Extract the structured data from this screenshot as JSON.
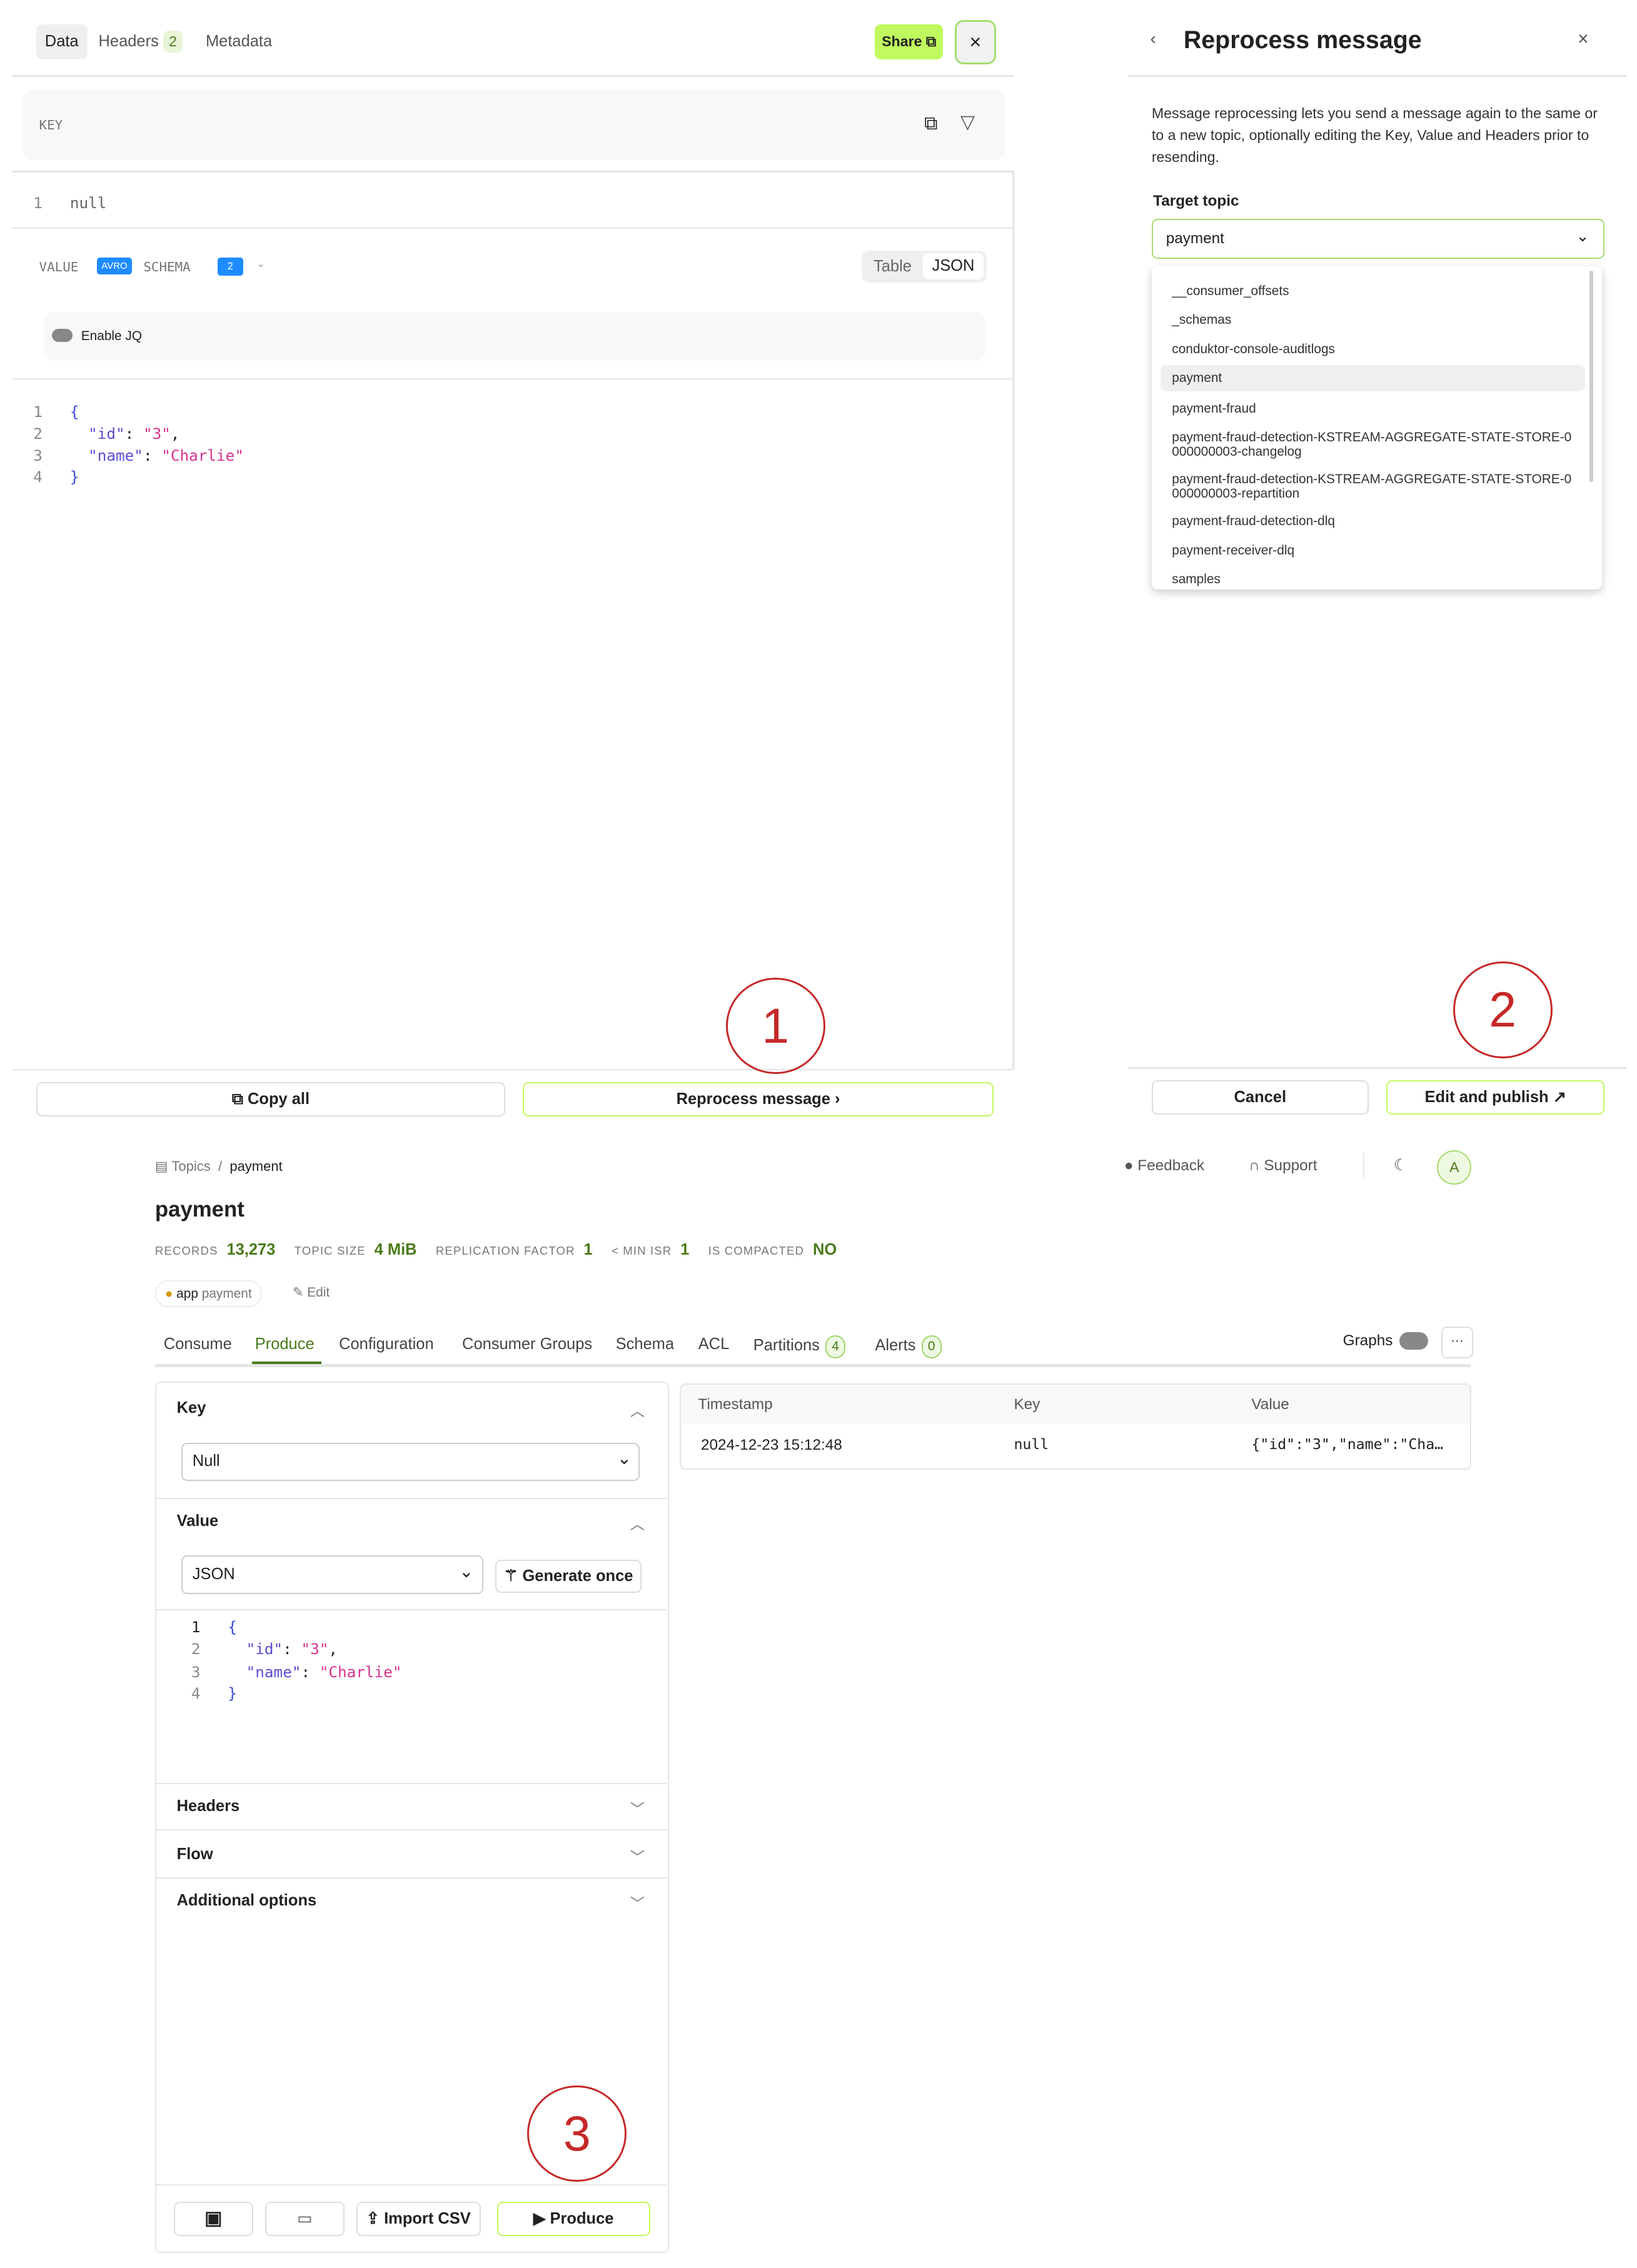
{
  "message_view": {
    "tabs": [
      {
        "label": "Data"
      },
      {
        "label": "Headers",
        "badge": "2"
      },
      {
        "label": "Metadata"
      }
    ],
    "share_label": "Share",
    "close_label": "×",
    "key_label": "KEY",
    "key_code": {
      "line": "1",
      "text": "null"
    },
    "value_label": "VALUE",
    "value_format": "AVRO",
    "schema_label": "SCHEMA",
    "schema_version": "2",
    "view_toggle": [
      "Table",
      "JSON"
    ],
    "view_selected": "JSON",
    "jq_label": "Enable JQ",
    "value_code": [
      {
        "n": "1",
        "text": "{"
      },
      {
        "n": "2",
        "k": "\"id\"",
        "v": "\"3\""
      },
      {
        "n": "3",
        "k": "\"name\"",
        "v": "\"Charlie\""
      },
      {
        "n": "4",
        "text": "}"
      }
    ],
    "copy_all_label": "Copy all",
    "reprocess_label": "Reprocess message"
  },
  "reprocess_panel": {
    "title": "Reprocess message",
    "description": "Message reprocessing lets you send a message again to the same or to a new topic, optionally editing the Key, Value and Headers prior to resending.",
    "target_topic_label": "Target topic",
    "selected_topic": "payment",
    "topic_options": [
      "__consumer_offsets",
      "_schemas",
      "conduktor-console-auditlogs",
      "payment",
      "payment-fraud",
      "payment-fraud-detection-KSTREAM-AGGREGATE-STATE-STORE-0000000003-changelog",
      "payment-fraud-detection-KSTREAM-AGGREGATE-STATE-STORE-0000000003-repartition",
      "payment-fraud-detection-dlq",
      "payment-receiver-dlq",
      "samples"
    ],
    "cancel_label": "Cancel",
    "publish_label": "Edit and publish ↗"
  },
  "annotations": [
    "1",
    "2",
    "3"
  ],
  "topic_page": {
    "breadcrumb": [
      "Topics",
      "payment"
    ],
    "feedback_label": "Feedback",
    "support_label": "Support",
    "avatar": "A",
    "title": "payment",
    "stats": [
      {
        "label": "RECORDS",
        "value": "13,273"
      },
      {
        "label": "TOPIC SIZE",
        "value": "4 MiB"
      },
      {
        "label": "REPLICATION FACTOR",
        "value": "1"
      },
      {
        "label": "< MIN ISR",
        "value": "1"
      },
      {
        "label": "IS COMPACTED",
        "value": "NO"
      }
    ],
    "label_key": "app",
    "label_value": "payment",
    "edit_label": "Edit",
    "tabs": [
      {
        "label": "Consume"
      },
      {
        "label": "Produce"
      },
      {
        "label": "Configuration"
      },
      {
        "label": "Consumer Groups"
      },
      {
        "label": "Schema"
      },
      {
        "label": "ACL"
      },
      {
        "label": "Partitions",
        "badge": "4"
      },
      {
        "label": "Alerts",
        "badge": "0"
      }
    ],
    "active_tab": "Produce",
    "graphs_label": "Graphs",
    "more_label": "···",
    "produce": {
      "key_label": "Key",
      "key_type": "Null",
      "value_label": "Value",
      "value_type": "JSON",
      "generate_label": "Generate once",
      "headers_label": "Headers",
      "flow_label": "Flow",
      "additional_label": "Additional options",
      "import_csv_label": "Import CSV",
      "produce_label": "Produce"
    },
    "results": {
      "columns": [
        "Timestamp",
        "Key",
        "Value"
      ],
      "rows": [
        {
          "timestamp": "2024-12-23 15:12:48",
          "key": "null",
          "value": "{\"id\":\"3\",\"name\":\"Cha…"
        }
      ]
    }
  },
  "colors": {
    "accent": "#c0fa5e",
    "accent_text": "#4a7a1a",
    "annotation": "#c62828",
    "avro_badge": "#1e8cff"
  }
}
